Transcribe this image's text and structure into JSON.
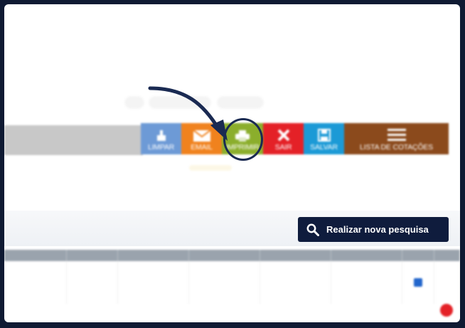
{
  "toolbar": {
    "limpar": "LIMPAR",
    "email": "EMAIL",
    "imprimir": "IMPRIMIR",
    "sair": "SAIR",
    "salvar": "SALVAR",
    "lista": "LISTA DE COTAÇÕES"
  },
  "search": {
    "label": "Realizar nova pesquisa"
  },
  "table": {
    "headers": [
      "",
      "",
      "",
      "",
      "",
      "",
      "",
      ""
    ],
    "rows": [
      [
        "",
        "",
        "",
        "",
        "",
        "",
        "",
        ""
      ]
    ]
  },
  "colors": {
    "limpar": "#6d9ad6",
    "email": "#f0821e",
    "imprimir": "#8bae2c",
    "sair": "#e42127",
    "salvar": "#1c9ad6",
    "lista": "#8b4a1c",
    "accent": "#0f1c3d"
  }
}
